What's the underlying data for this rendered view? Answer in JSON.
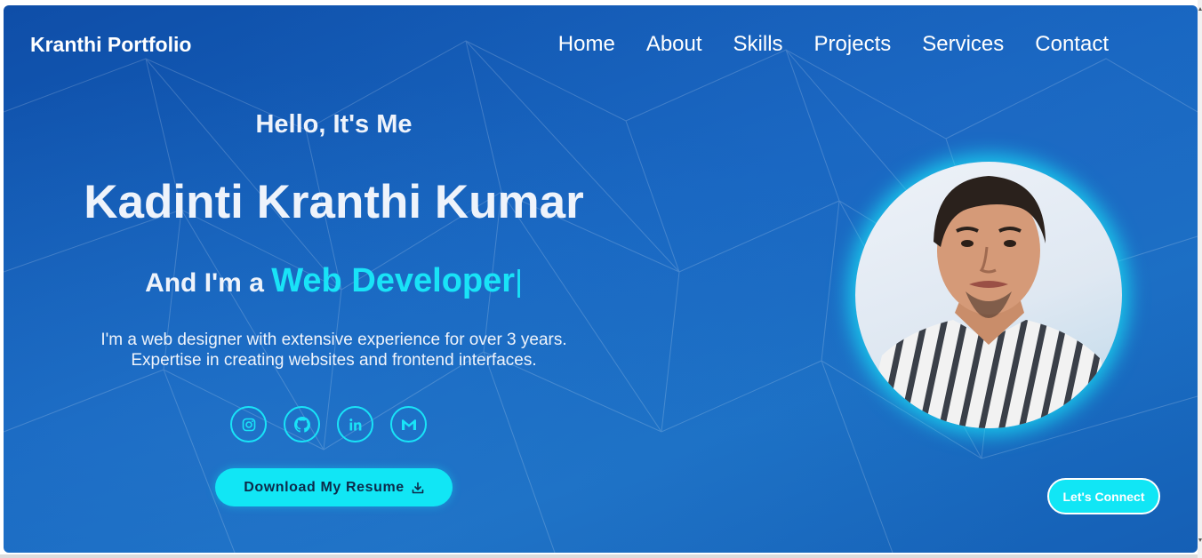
{
  "navbar": {
    "brand": "Kranthi Portfolio",
    "links": [
      "Home",
      "About",
      "Skills",
      "Projects",
      "Services",
      "Contact"
    ]
  },
  "hero": {
    "greeting": "Hello, It's Me",
    "name": "Kadinti Kranthi Kumar",
    "role_prefix": "And I'm a",
    "role": "Web Developer",
    "caret": "|",
    "bio_line1": "I'm a web designer with extensive experience for over 3 years.",
    "bio_line2": "Expertise in creating websites and frontend interfaces.",
    "resume_button": "Download My Resume",
    "connect_button": "Let's Connect"
  },
  "socials": [
    {
      "icon": "instagram-icon"
    },
    {
      "icon": "github-icon"
    },
    {
      "icon": "linkedin-icon"
    },
    {
      "icon": "gmail-icon"
    }
  ],
  "colors": {
    "background": "#1565c0",
    "accent": "#19e3f7",
    "text": "#eef3fb"
  }
}
